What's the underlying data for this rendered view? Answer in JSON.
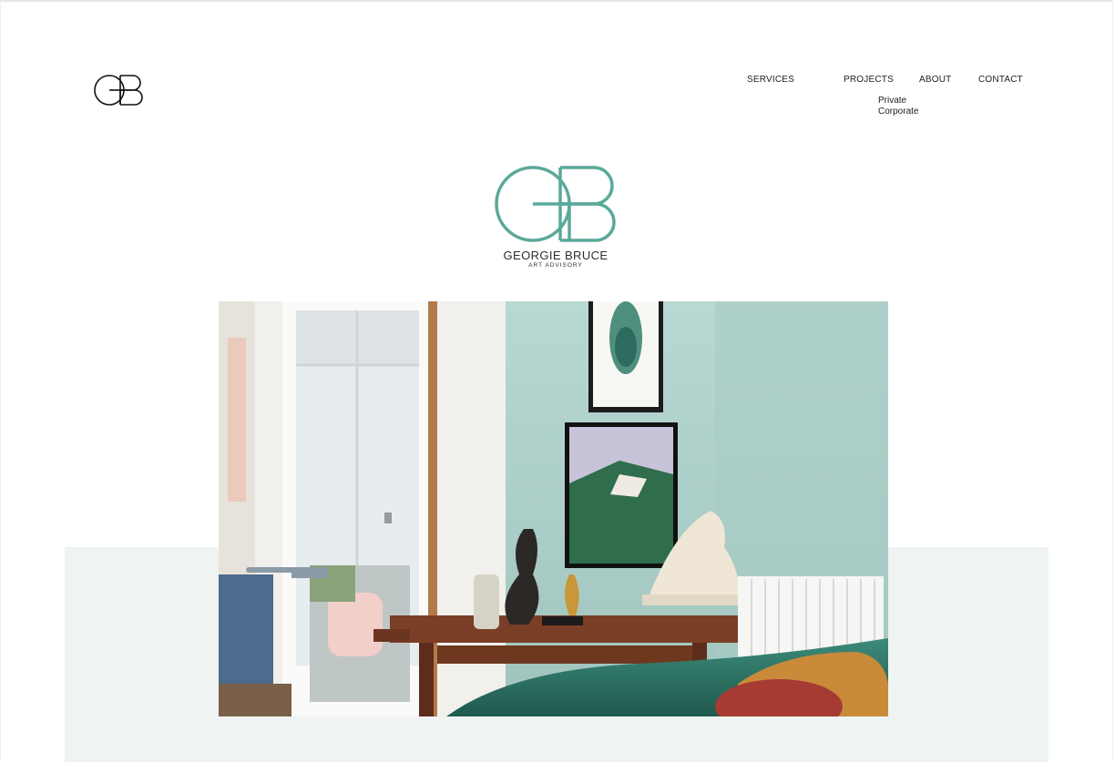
{
  "header": {
    "small_logo_alt": "GB",
    "nav": {
      "services": "SERVICES",
      "projects": "PROJECTS",
      "about": "ABOUT",
      "contact": "CONTACT"
    },
    "projects_submenu": [
      "Private",
      "Corporate"
    ]
  },
  "brand": {
    "monogram": "GB",
    "name": "GEORGIE BRUCE",
    "tagline": "ART ADVISORY"
  },
  "colors": {
    "brand_teal": "#5aa99a",
    "band_mint": "#eff4f2",
    "text": "#1d1d1d"
  },
  "hero": {
    "icon": "interior-photo"
  }
}
